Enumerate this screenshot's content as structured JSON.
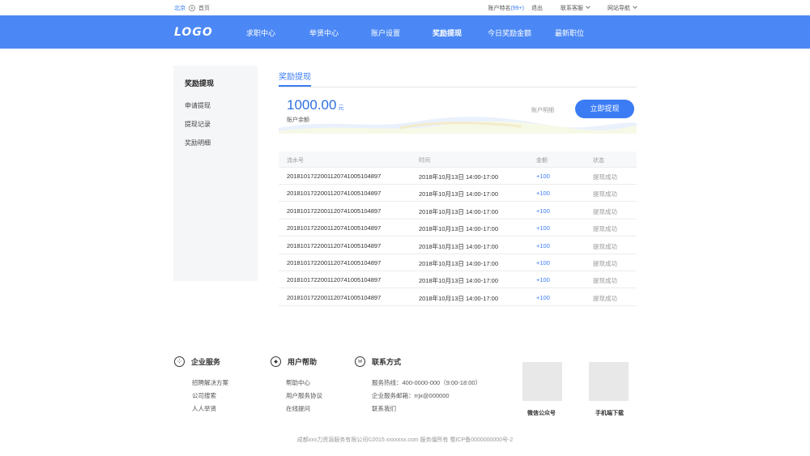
{
  "topbar": {
    "city": "北京",
    "home": "首页",
    "account": "账户特名",
    "count": "(99+)",
    "logout": "退出",
    "service": "联系客服",
    "site_nav": "网站导航"
  },
  "header": {
    "logo": "LOGO",
    "nav": [
      {
        "label": "求职中心"
      },
      {
        "label": "举贤中心"
      },
      {
        "label": "账户设置"
      },
      {
        "label": "奖励提现"
      },
      {
        "label": "今日奖励金额"
      },
      {
        "label": "最新职位"
      }
    ],
    "active_index": 3
  },
  "sidebar": {
    "title": "奖励提现",
    "items": [
      "申请提现",
      "提现记录",
      "奖励明细"
    ]
  },
  "main": {
    "tab": "奖励提现",
    "balance": "1000.00",
    "balance_unit": "元",
    "balance_label": "账户余额",
    "detail_link": "账户明细",
    "withdraw_button": "立即提现"
  },
  "table": {
    "headers": [
      "流水号",
      "时间",
      "金额",
      "状态"
    ],
    "rows": [
      [
        "201810172200112074100510 4897",
        "2018年10月13日 14:00-17:00",
        "+100",
        "提现成功"
      ],
      [
        "20181017220011207410051 04897",
        "2018年10月13日 14:00-17:00",
        "+100",
        "提现成功"
      ],
      [
        "201810172200112074100510 4897",
        "2018年10月13日 14:00-17:00",
        "+100",
        "提现成功"
      ],
      [
        "201810172200112074100510 4897",
        "2018年10月13日 14:00-17:00",
        "+100",
        "提现成功"
      ],
      [
        "201810172200112074100510 4897",
        "2018年10月13日 14:00-17:00",
        "+100",
        "提现成功"
      ],
      [
        "201810172200112074100510 4897",
        "2018年10月13日 14:00-17:00",
        "+100",
        "提现成功"
      ],
      [
        "201810172200112074100510 4897",
        "2018年10月13日 14:00-17:00",
        "+100",
        "提现成功"
      ],
      [
        "201810172200112074100510 4897",
        "2018年10月13日 14:00-17:00",
        "+100",
        "提现成功"
      ]
    ]
  },
  "footer": {
    "columns": [
      {
        "title": "企业服务",
        "icon": "grid-icon",
        "links": [
          "招聘解决方案",
          "公司搜索",
          "人人举贤"
        ]
      },
      {
        "title": "用户帮助",
        "icon": "shield-icon",
        "links": [
          "帮助中心",
          "用户服务协议",
          "在线提问"
        ]
      },
      {
        "title": "联系方式",
        "icon": "contact-icon",
        "links": [
          "服务热线：400-0000-000（9:00-18:00）",
          "企业服务邮箱：rrjx@000000",
          "联系我们"
        ]
      }
    ],
    "qr_wechat": "微信公众号",
    "qr_app": "手机端下载",
    "copyright": "成都xxx力资源服务有限公司©2015 xxxxxxx.com    服务僵所有    蜀ICP备0000000000号-2"
  },
  "colors": {
    "brand": "#4b88f5",
    "accent": "#3b7cf5"
  }
}
